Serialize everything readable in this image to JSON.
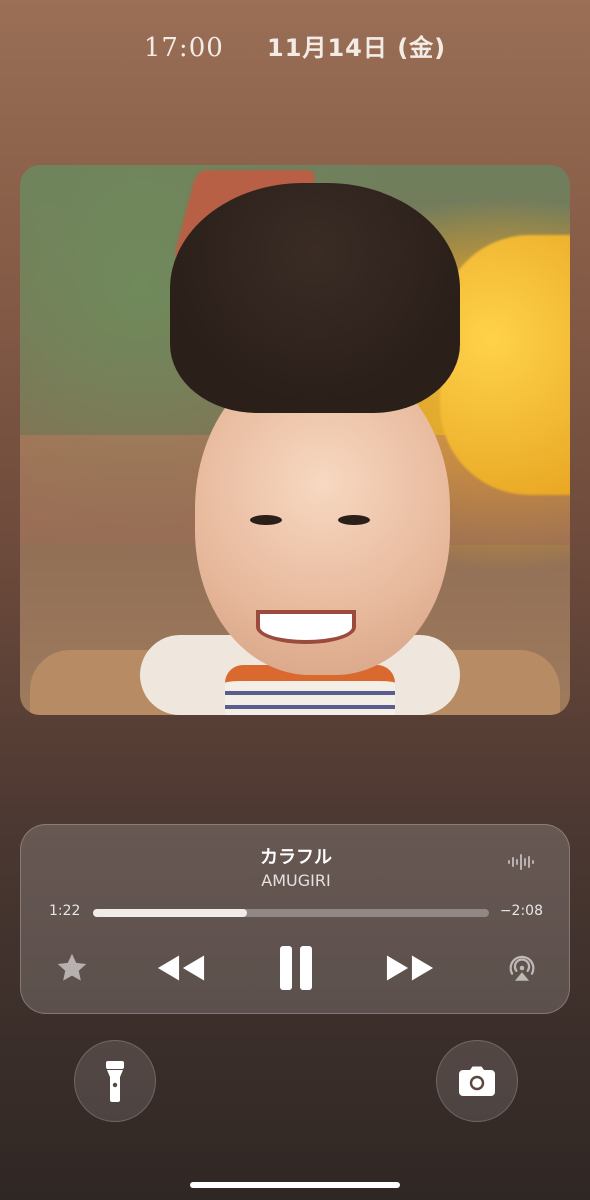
{
  "status": {
    "time": "17:00",
    "date": "11月14日 (金)"
  },
  "now_playing": {
    "title": "カラフル",
    "artist": "AMUGIRI",
    "elapsed": "1:22",
    "remaining": "−2:08",
    "progress_fraction": 0.39
  },
  "controls": {
    "favorite_icon": "star-icon",
    "rewind_icon": "rewind-icon",
    "playpause_icon": "pause-icon",
    "forward_icon": "fast-forward-icon",
    "airplay_icon": "airplay-audio-icon",
    "waveform_icon": "waveform-icon"
  },
  "quick_actions": {
    "left_icon": "flashlight-icon",
    "right_icon": "camera-icon"
  },
  "colors": {
    "progress_fill": "#f1ece8",
    "progress_track": "rgba(255,255,255,0.30)"
  }
}
